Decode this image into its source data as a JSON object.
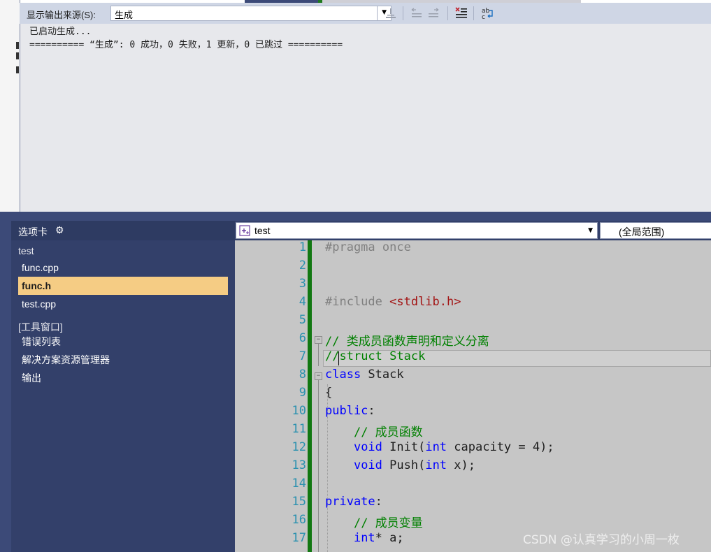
{
  "output": {
    "source_label": "显示输出来源(S):",
    "source_value": "生成",
    "lines": [
      "已启动生成...",
      "========== “生成”: 0 成功，0 失败，1 更新，0 已跳过 =========="
    ],
    "toolbar_icons": [
      "goto-error-icon",
      "prev-message-icon",
      "next-message-icon",
      "clear-all-icon",
      "word-wrap-icon"
    ]
  },
  "tabs_panel": {
    "title": "选项卡",
    "settings_icon": "gear-icon",
    "groups": [
      {
        "label": "test",
        "items": [
          {
            "label": "func.cpp",
            "selected": false
          },
          {
            "label": "func.h",
            "selected": true
          },
          {
            "label": "test.cpp",
            "selected": false
          }
        ]
      },
      {
        "label": "[工具窗口]",
        "items": [
          {
            "label": "错误列表",
            "selected": false
          },
          {
            "label": "解决方案资源管理器",
            "selected": false
          },
          {
            "label": "输出",
            "selected": false
          }
        ]
      }
    ]
  },
  "navbar": {
    "project": "test",
    "scope": "(全局范围)"
  },
  "editor": {
    "line_numbers": [
      "1",
      "2",
      "3",
      "4",
      "5",
      "6",
      "7",
      "8",
      "9",
      "10",
      "11",
      "12",
      "13",
      "14",
      "15",
      "16",
      "17"
    ],
    "lines": [
      [
        {
          "t": "#pragma once",
          "c": "pp"
        }
      ],
      [],
      [],
      [
        {
          "t": "#include ",
          "c": "pp"
        },
        {
          "t": "<stdlib.h>",
          "c": "str"
        }
      ],
      [],
      [
        {
          "t": "// 类成员函数声明和定义分离",
          "c": "cm"
        }
      ],
      [
        {
          "t": "//",
          "c": "cm"
        },
        {
          "t": "struct Stack",
          "c": "cm"
        }
      ],
      [
        {
          "t": "class",
          "c": "kw"
        },
        {
          "t": " Stack",
          "c": "tx"
        }
      ],
      [
        {
          "t": "{",
          "c": "tx"
        }
      ],
      [
        {
          "t": "public",
          "c": "kw"
        },
        {
          "t": ":",
          "c": "tx"
        }
      ],
      [
        {
          "t": "    ",
          "c": "tx"
        },
        {
          "t": "// 成员函数",
          "c": "cm"
        }
      ],
      [
        {
          "t": "    ",
          "c": "tx"
        },
        {
          "t": "void",
          "c": "kw"
        },
        {
          "t": " Init(",
          "c": "tx"
        },
        {
          "t": "int",
          "c": "kw"
        },
        {
          "t": " capacity = 4);",
          "c": "tx"
        }
      ],
      [
        {
          "t": "    ",
          "c": "tx"
        },
        {
          "t": "void",
          "c": "kw"
        },
        {
          "t": " Push(",
          "c": "tx"
        },
        {
          "t": "int",
          "c": "kw"
        },
        {
          "t": " x);",
          "c": "tx"
        }
      ],
      [],
      [
        {
          "t": "private",
          "c": "kw"
        },
        {
          "t": ":",
          "c": "tx"
        }
      ],
      [
        {
          "t": "    ",
          "c": "tx"
        },
        {
          "t": "// 成员变量",
          "c": "cm"
        }
      ],
      [
        {
          "t": "    ",
          "c": "tx"
        },
        {
          "t": "int",
          "c": "kw"
        },
        {
          "t": "* a;",
          "c": "tx"
        }
      ]
    ]
  },
  "watermark": "CSDN @认真学习的小周一枚"
}
